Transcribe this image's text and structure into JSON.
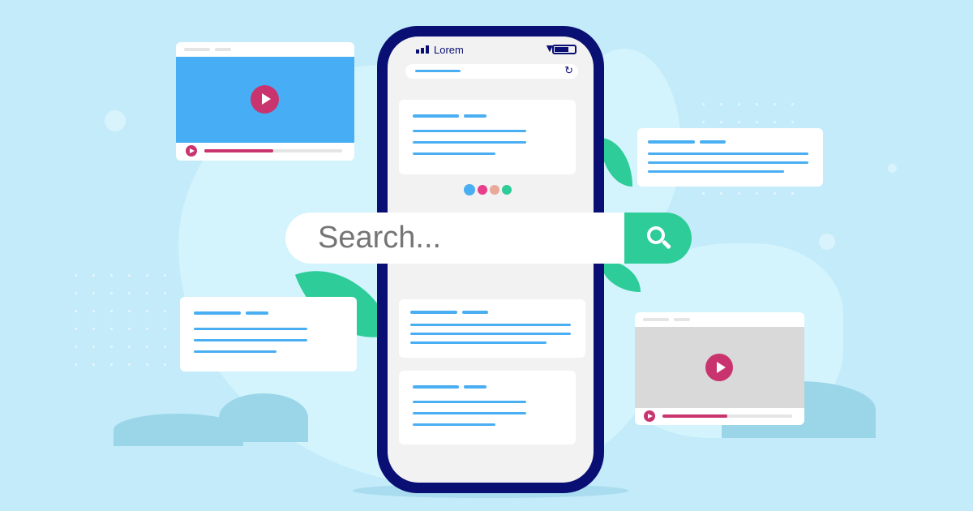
{
  "phone": {
    "carrier": "Lorem",
    "icons": [
      "signal-icon",
      "wifi-icon",
      "battery-icon",
      "refresh-icon"
    ]
  },
  "search": {
    "placeholder": "Search...",
    "icon": "search-icon"
  },
  "colors": {
    "background": "#c3ebfa",
    "phone_frame": "#0a0f73",
    "accent_green": "#2ecc98",
    "accent_blue": "#4aaef2",
    "play": "#c9346e",
    "text": "#0a0f73"
  },
  "video_cards": [
    {
      "progress": 0.5
    },
    {
      "progress": 0.5
    }
  ],
  "dots": [
    "#4aaef2",
    "#e83e8c",
    "#e8a99a",
    "#2ecc98"
  ]
}
